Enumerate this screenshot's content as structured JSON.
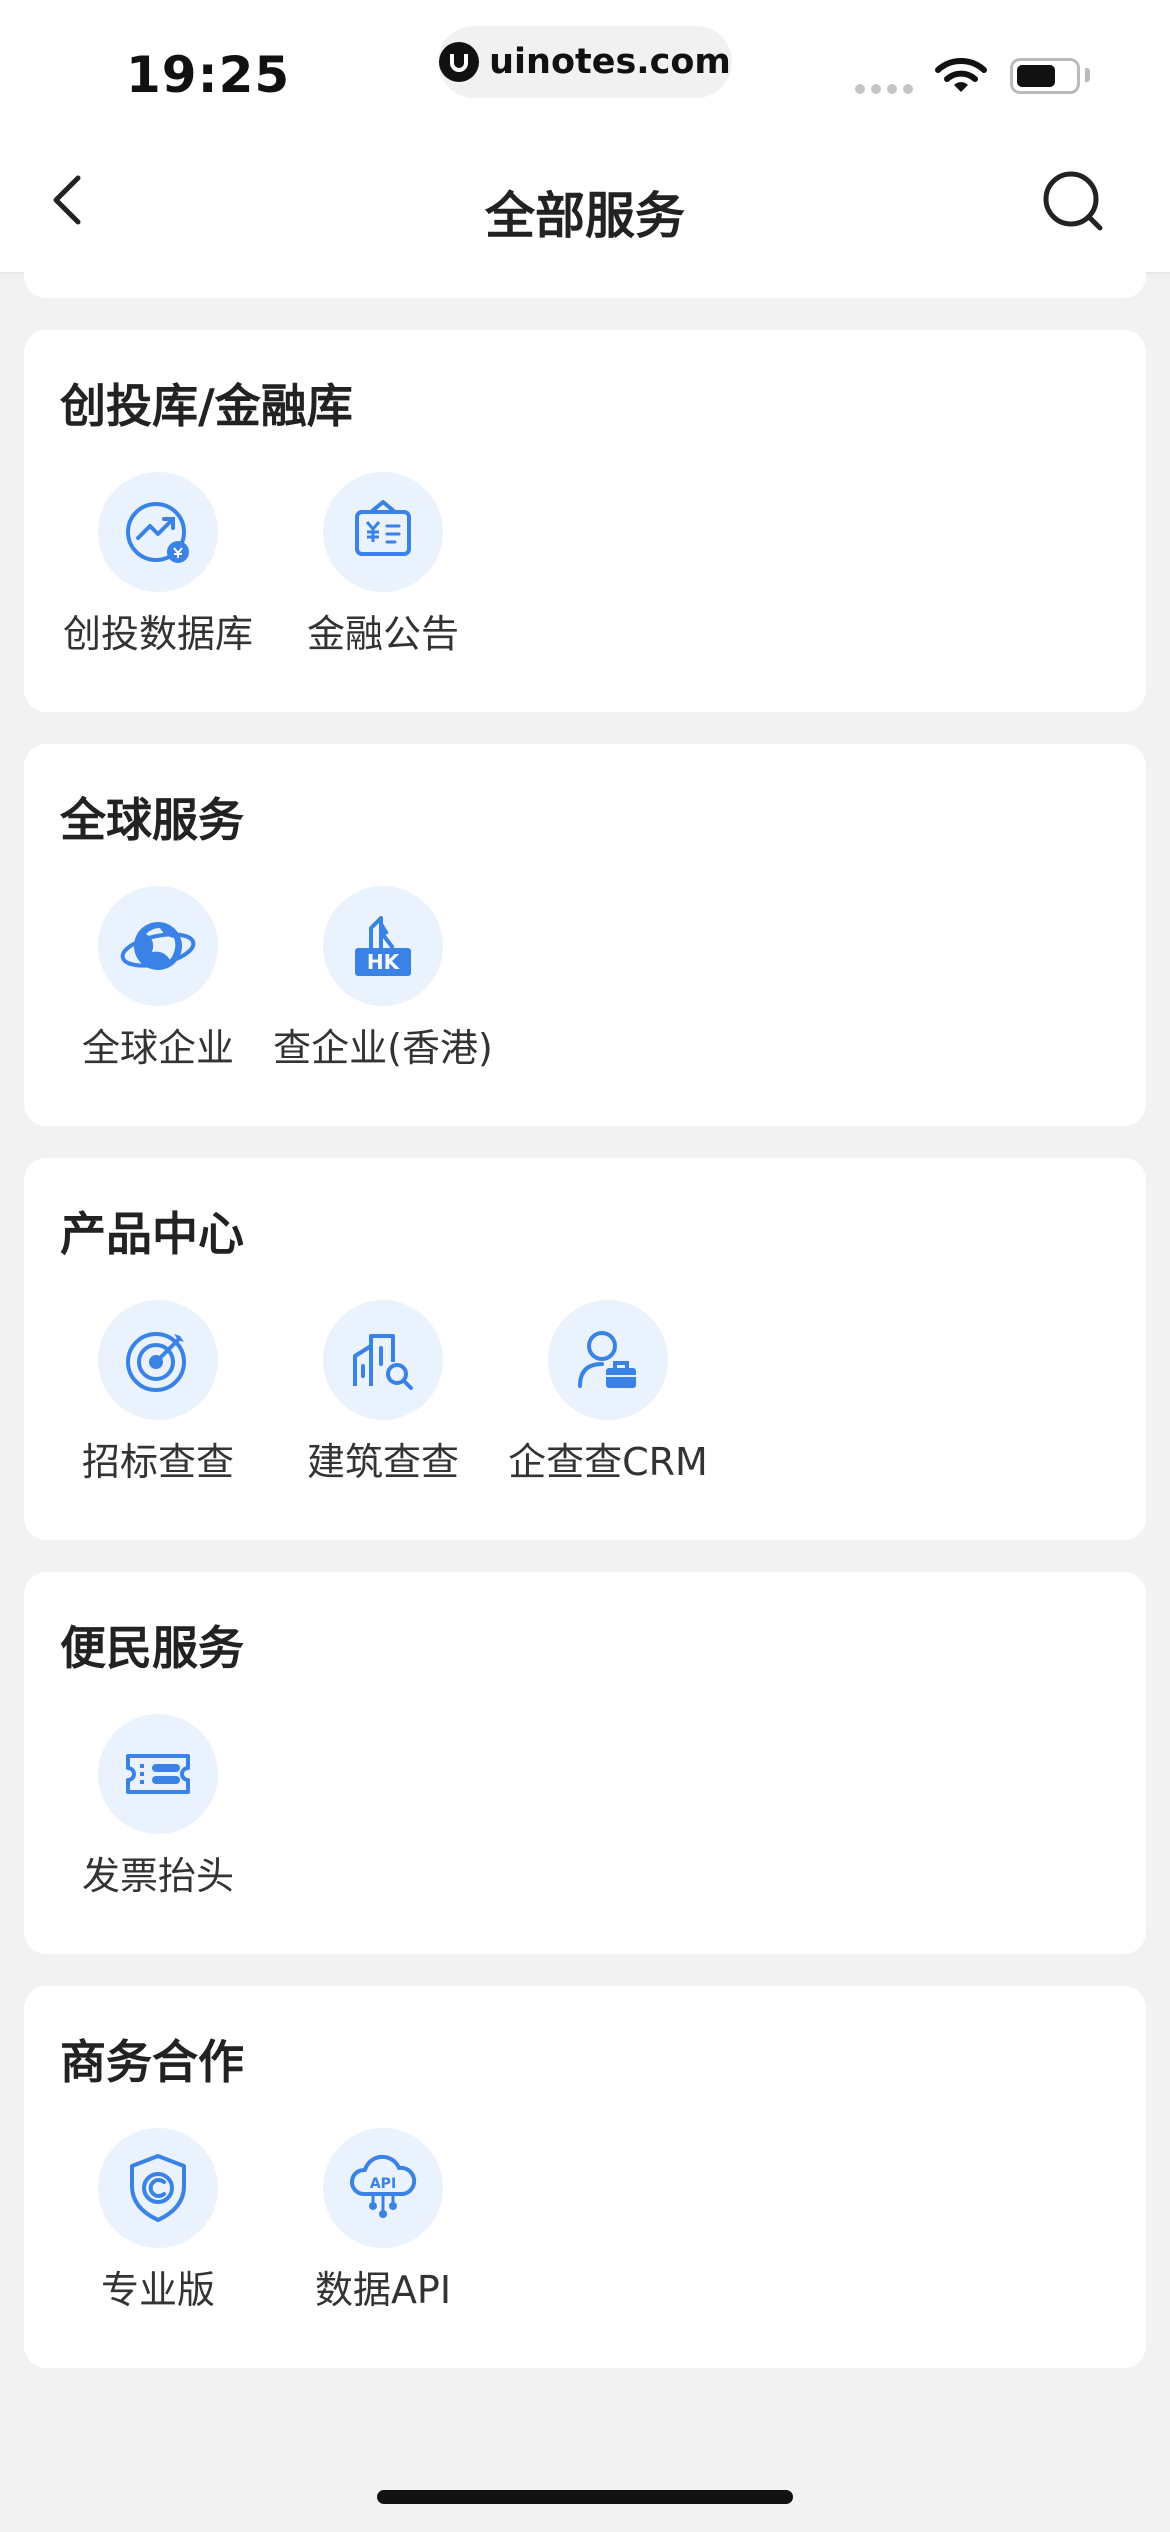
{
  "status_bar": {
    "time": "19:25",
    "url": "uinotes.com"
  },
  "nav": {
    "title": "全部服务"
  },
  "sections": [
    {
      "title": "创投库/金融库",
      "items": [
        {
          "label": "创投数据库",
          "icon": "chart-trend-icon"
        },
        {
          "label": "金融公告",
          "icon": "finance-notice-icon"
        }
      ]
    },
    {
      "title": "全球服务",
      "items": [
        {
          "label": "全球企业",
          "icon": "globe-icon"
        },
        {
          "label": "查企业(香港)",
          "icon": "hk-building-icon"
        }
      ]
    },
    {
      "title": "产品中心",
      "items": [
        {
          "label": "招标查查",
          "icon": "target-icon"
        },
        {
          "label": "建筑查查",
          "icon": "building-search-icon"
        },
        {
          "label": "企查查CRM",
          "icon": "person-briefcase-icon"
        }
      ]
    },
    {
      "title": "便民服务",
      "items": [
        {
          "label": "发票抬头",
          "icon": "ticket-icon"
        }
      ]
    },
    {
      "title": "商务合作",
      "items": [
        {
          "label": "专业版",
          "icon": "shield-icon"
        },
        {
          "label": "数据API",
          "icon": "api-cloud-icon"
        }
      ]
    }
  ],
  "colors": {
    "accent": "#3b82e6",
    "icon_bg": "#e9f2fd",
    "page_bg": "#f2f2f2"
  }
}
